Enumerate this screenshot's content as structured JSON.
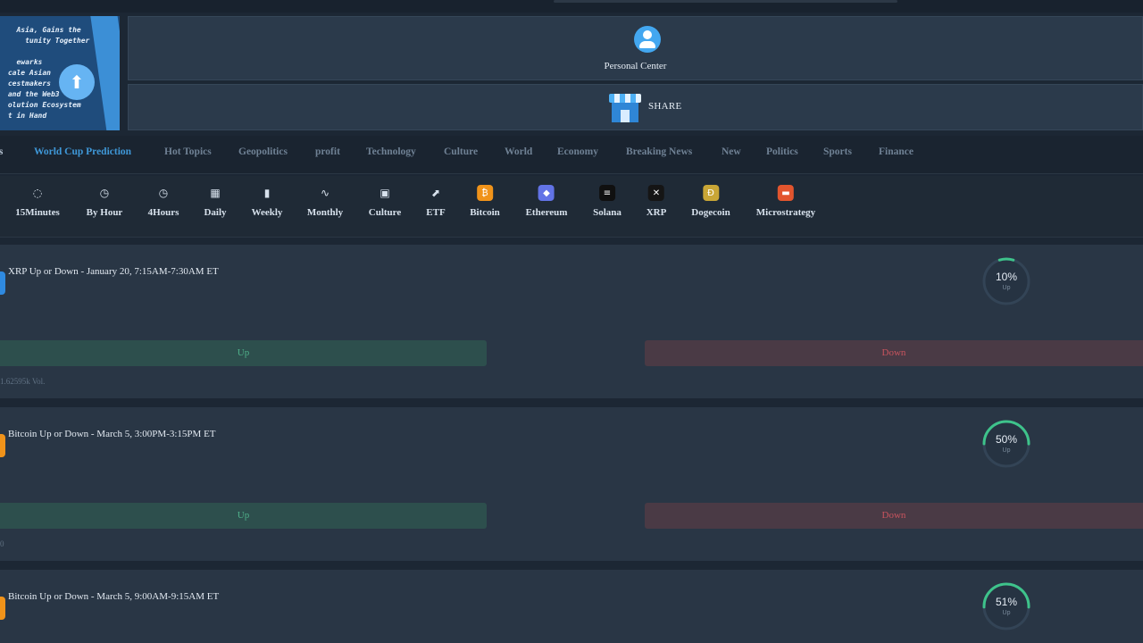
{
  "banner": {
    "lines": [
      "   Asia, Gains the",
      "     tunity Together",
      "",
      "   ewarks",
      " cale Asian",
      " cestmakers",
      " and the Web3",
      " olution Ecosystem",
      " t in Hand"
    ]
  },
  "header": {
    "personal_center_label": "Personal Center",
    "share_label": "SHARE"
  },
  "tabs": [
    {
      "label": "ets"
    },
    {
      "label": "World Cup Prediction",
      "active": true
    },
    {
      "label": "Hot Topics"
    },
    {
      "label": "Geopolitics"
    },
    {
      "label": "profit"
    },
    {
      "label": "Technology"
    },
    {
      "label": "Culture"
    },
    {
      "label": "World"
    },
    {
      "label": "Economy"
    },
    {
      "label": "Breaking News"
    },
    {
      "label": "New"
    },
    {
      "label": "Politics"
    },
    {
      "label": "Sports"
    },
    {
      "label": "Finance"
    }
  ],
  "categories": [
    {
      "label": "15Minutes",
      "icon": "dashed-clock-icon",
      "glyph": "◌",
      "color": ""
    },
    {
      "label": "By Hour",
      "icon": "clock-icon",
      "glyph": "◷",
      "color": ""
    },
    {
      "label": "4Hours",
      "icon": "clock-icon",
      "glyph": "◷",
      "color": ""
    },
    {
      "label": "Daily",
      "icon": "calendar-icon",
      "glyph": "▦",
      "color": ""
    },
    {
      "label": "Weekly",
      "icon": "bar-chart-icon",
      "glyph": "▮",
      "color": ""
    },
    {
      "label": "Monthly",
      "icon": "pulse-icon",
      "glyph": "∿",
      "color": ""
    },
    {
      "label": "Culture",
      "icon": "image-icon",
      "glyph": "▣",
      "color": ""
    },
    {
      "label": "ETF",
      "icon": "trend-icon",
      "glyph": "⬈",
      "color": ""
    },
    {
      "label": "Bitcoin",
      "icon": "bitcoin-icon",
      "glyph": "₿",
      "color": "#f0931a"
    },
    {
      "label": "Ethereum",
      "icon": "ethereum-icon",
      "glyph": "◆",
      "color": "#6273e6"
    },
    {
      "label": "Solana",
      "icon": "solana-icon",
      "glyph": "≡",
      "color": "#101010"
    },
    {
      "label": "XRP",
      "icon": "xrp-icon",
      "glyph": "✕",
      "color": "#151515"
    },
    {
      "label": "Dogecoin",
      "icon": "dogecoin-icon",
      "glyph": "Ð",
      "color": "#c9a636"
    },
    {
      "label": "Microstrategy",
      "icon": "microstrategy-icon",
      "glyph": "▬",
      "color": "#e2552e"
    }
  ],
  "markets": [
    {
      "title": "XRP Up or Down - January 20, 7:15AM-7:30AM ET",
      "coin_color": "#2f8ae0",
      "up_label": "Up",
      "down_label": "Down",
      "volume": "1.62595k Vol.",
      "percent_label": "10%",
      "percent_value": 0.1,
      "percent_sub": "Up",
      "gauge_color": "#3ec38b"
    },
    {
      "title": "Bitcoin Up or Down - March 5, 3:00PM-3:15PM ET",
      "coin_color": "#f0931a",
      "up_label": "Up",
      "down_label": "Down",
      "volume": "0",
      "percent_label": "50%",
      "percent_value": 0.5,
      "percent_sub": "Up",
      "gauge_color": "#3ec38b"
    },
    {
      "title": "Bitcoin Up or Down - March 5, 9:00AM-9:15AM ET",
      "coin_color": "#f0931a",
      "up_label": "Up",
      "down_label": "Down",
      "volume": "",
      "percent_label": "51%",
      "percent_value": 0.51,
      "percent_sub": "Up",
      "gauge_color": "#3ec38b"
    }
  ]
}
